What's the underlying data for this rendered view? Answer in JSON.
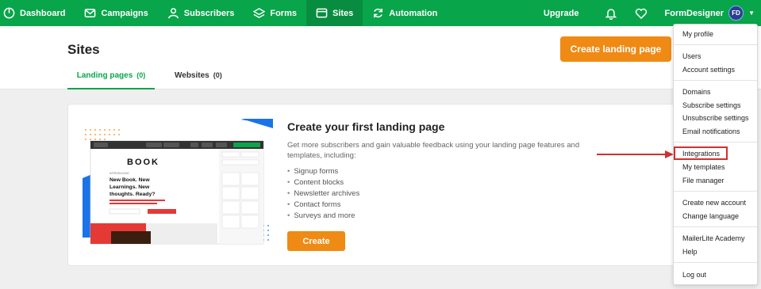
{
  "nav": {
    "items": [
      {
        "label": "Dashboard",
        "icon": "dashboard-icon"
      },
      {
        "label": "Campaigns",
        "icon": "envelope-icon"
      },
      {
        "label": "Subscribers",
        "icon": "user-icon"
      },
      {
        "label": "Forms",
        "icon": "layers-icon"
      },
      {
        "label": "Sites",
        "icon": "browser-icon"
      },
      {
        "label": "Automation",
        "icon": "refresh-icon"
      }
    ],
    "active": "Sites",
    "upgrade": "Upgrade",
    "account_name": "FormDesigner",
    "avatar_initials": "FD"
  },
  "header": {
    "title": "Sites",
    "create_button": "Create landing page",
    "tabs": [
      {
        "label": "Landing pages",
        "count": "(0)"
      },
      {
        "label": "Websites",
        "count": "(0)"
      }
    ]
  },
  "card": {
    "title": "Create your first landing page",
    "description": "Get more subscribers and gain valuable feedback using your landing page features and templates, including:",
    "features": [
      "Signup forms",
      "Content blocks",
      "Newsletter archives",
      "Contact forms",
      "Surveys and more"
    ],
    "button": "Create",
    "illustration": {
      "logo": "BOOK",
      "kicker": "INTRODUCING",
      "headline": "New Book. New Learnings. New thoughts. Ready?"
    }
  },
  "dropdown": {
    "items": [
      "My profile",
      "Users",
      "Account settings",
      "Domains",
      "Subscribe settings",
      "Unsubscribe settings",
      "Email notifications",
      "Integrations",
      "My templates",
      "File manager",
      "Create new account",
      "Change language",
      "MailerLite Academy",
      "Help",
      "Log out"
    ],
    "highlighted": "Integrations"
  },
  "colors": {
    "brand_green": "#09a54a",
    "accent_orange": "#ef8a14",
    "highlight_red": "#d32f2f"
  }
}
